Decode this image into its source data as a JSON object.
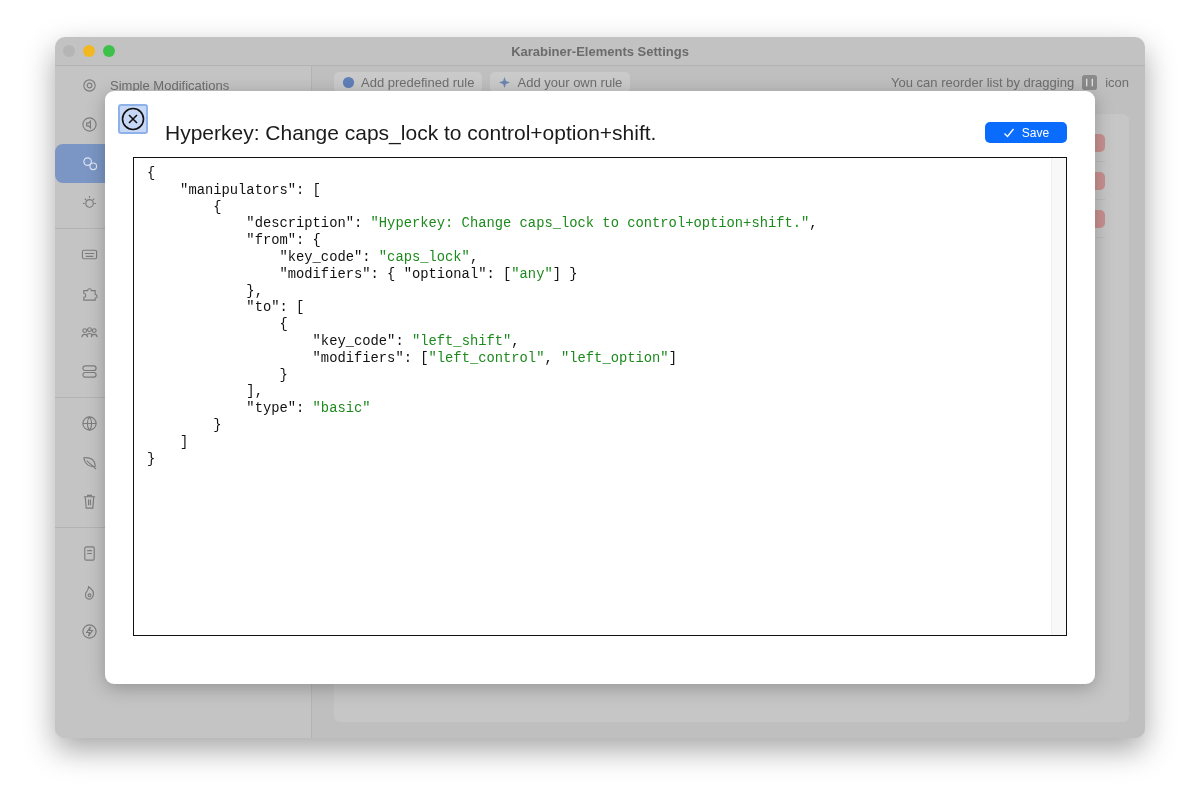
{
  "window": {
    "title": "Karabiner-Elements Settings"
  },
  "sidebar": {
    "groups": [
      {
        "items": [
          {
            "label": "Simple Modifications",
            "selected": false
          },
          {
            "selected": false
          },
          {
            "selected": true
          },
          {
            "selected": false
          }
        ]
      },
      {
        "items": [
          {
            "selected": false
          },
          {
            "selected": false
          },
          {
            "selected": false
          },
          {
            "selected": false
          }
        ]
      },
      {
        "items": [
          {
            "selected": false
          },
          {
            "selected": false
          },
          {
            "selected": false
          }
        ]
      },
      {
        "items": [
          {
            "selected": false
          },
          {
            "selected": false
          },
          {
            "selected": false
          }
        ]
      }
    ]
  },
  "toolbar": {
    "buttons": [
      {
        "label": "Add predefined rule"
      },
      {
        "label": "Add your own rule"
      }
    ],
    "hint": "You can reorder list by dragging",
    "hint_suffix": "icon"
  },
  "dialog": {
    "title": "Hyperkey: Change caps_lock to control+option+shift.",
    "save_label": "Save",
    "code_lines": [
      [
        {
          "kind": "plain",
          "text": "{"
        }
      ],
      [
        {
          "kind": "plain",
          "text": "    \"manipulators\": ["
        }
      ],
      [
        {
          "kind": "plain",
          "text": "        {"
        }
      ],
      [
        {
          "kind": "plain",
          "text": "            \"description\": "
        },
        {
          "kind": "string",
          "text": "\"Hyperkey: Change caps_lock to control+option+shift.\""
        },
        {
          "kind": "plain",
          "text": ","
        }
      ],
      [
        {
          "kind": "plain",
          "text": "            \"from\": {"
        }
      ],
      [
        {
          "kind": "plain",
          "text": "                \"key_code\": "
        },
        {
          "kind": "string",
          "text": "\"caps_lock\""
        },
        {
          "kind": "plain",
          "text": ","
        }
      ],
      [
        {
          "kind": "plain",
          "text": "                \"modifiers\": { \"optional\": ["
        },
        {
          "kind": "string",
          "text": "\"any\""
        },
        {
          "kind": "plain",
          "text": "] }"
        }
      ],
      [
        {
          "kind": "plain",
          "text": "            },"
        }
      ],
      [
        {
          "kind": "plain",
          "text": "            \"to\": ["
        }
      ],
      [
        {
          "kind": "plain",
          "text": "                {"
        }
      ],
      [
        {
          "kind": "plain",
          "text": "                    \"key_code\": "
        },
        {
          "kind": "string",
          "text": "\"left_shift\""
        },
        {
          "kind": "plain",
          "text": ","
        }
      ],
      [
        {
          "kind": "plain",
          "text": "                    \"modifiers\": ["
        },
        {
          "kind": "string",
          "text": "\"left_control\""
        },
        {
          "kind": "plain",
          "text": ", "
        },
        {
          "kind": "string",
          "text": "\"left_option\""
        },
        {
          "kind": "plain",
          "text": "]"
        }
      ],
      [
        {
          "kind": "plain",
          "text": "                }"
        }
      ],
      [
        {
          "kind": "plain",
          "text": "            ],"
        }
      ],
      [
        {
          "kind": "plain",
          "text": "            \"type\": "
        },
        {
          "kind": "string",
          "text": "\"basic\""
        }
      ],
      [
        {
          "kind": "plain",
          "text": "        }"
        }
      ],
      [
        {
          "kind": "plain",
          "text": "    ]"
        }
      ],
      [
        {
          "kind": "plain",
          "text": "}"
        }
      ]
    ]
  }
}
